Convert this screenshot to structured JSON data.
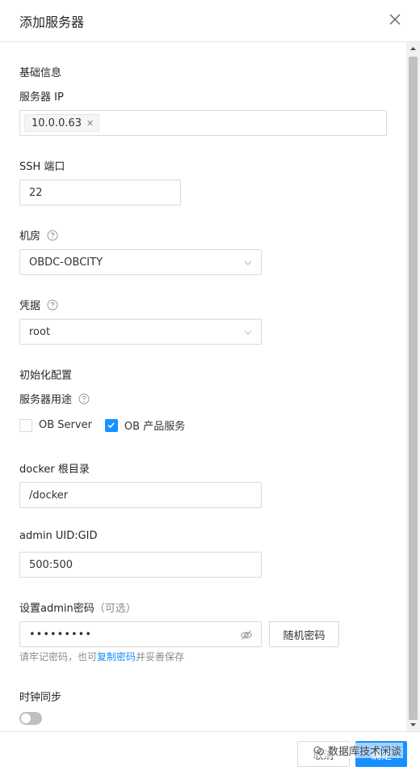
{
  "header": {
    "title": "添加服务器"
  },
  "basic": {
    "section_title": "基础信息",
    "ip_label": "服务器 IP",
    "ip_tag": "10.0.0.63",
    "ssh_label": "SSH 端口",
    "ssh_value": "22",
    "room_label": "机房",
    "room_value": "OBDC-OBCITY",
    "credential_label": "凭据",
    "credential_value": "root"
  },
  "init": {
    "section_title": "初始化配置",
    "usage_label": "服务器用途",
    "options": [
      {
        "label": "OB Server",
        "checked": false
      },
      {
        "label": "OB 产品服务",
        "checked": true
      }
    ],
    "docker_label": "docker 根目录",
    "docker_value": "/docker",
    "uid_label": "admin UID:GID",
    "uid_value": "500:500",
    "password_label": "设置admin密码",
    "password_optional": "（可选）",
    "password_value": "•••••••••",
    "random_button": "随机密码",
    "hint_prefix": "请牢记密码，也可",
    "hint_link": "复制密码",
    "hint_suffix": "并妥善保存",
    "clock_label": "时钟同步",
    "clock_on": false
  },
  "footer": {
    "cancel_label": "取消",
    "ok_label": "确定",
    "watermark": "数据库技术闲谈"
  },
  "colors": {
    "primary": "#1890ff",
    "border": "#d9d9d9"
  },
  "icons": [
    "close-icon",
    "help-icon",
    "chevron-down-icon",
    "eye-invisible-icon",
    "check-icon"
  ]
}
